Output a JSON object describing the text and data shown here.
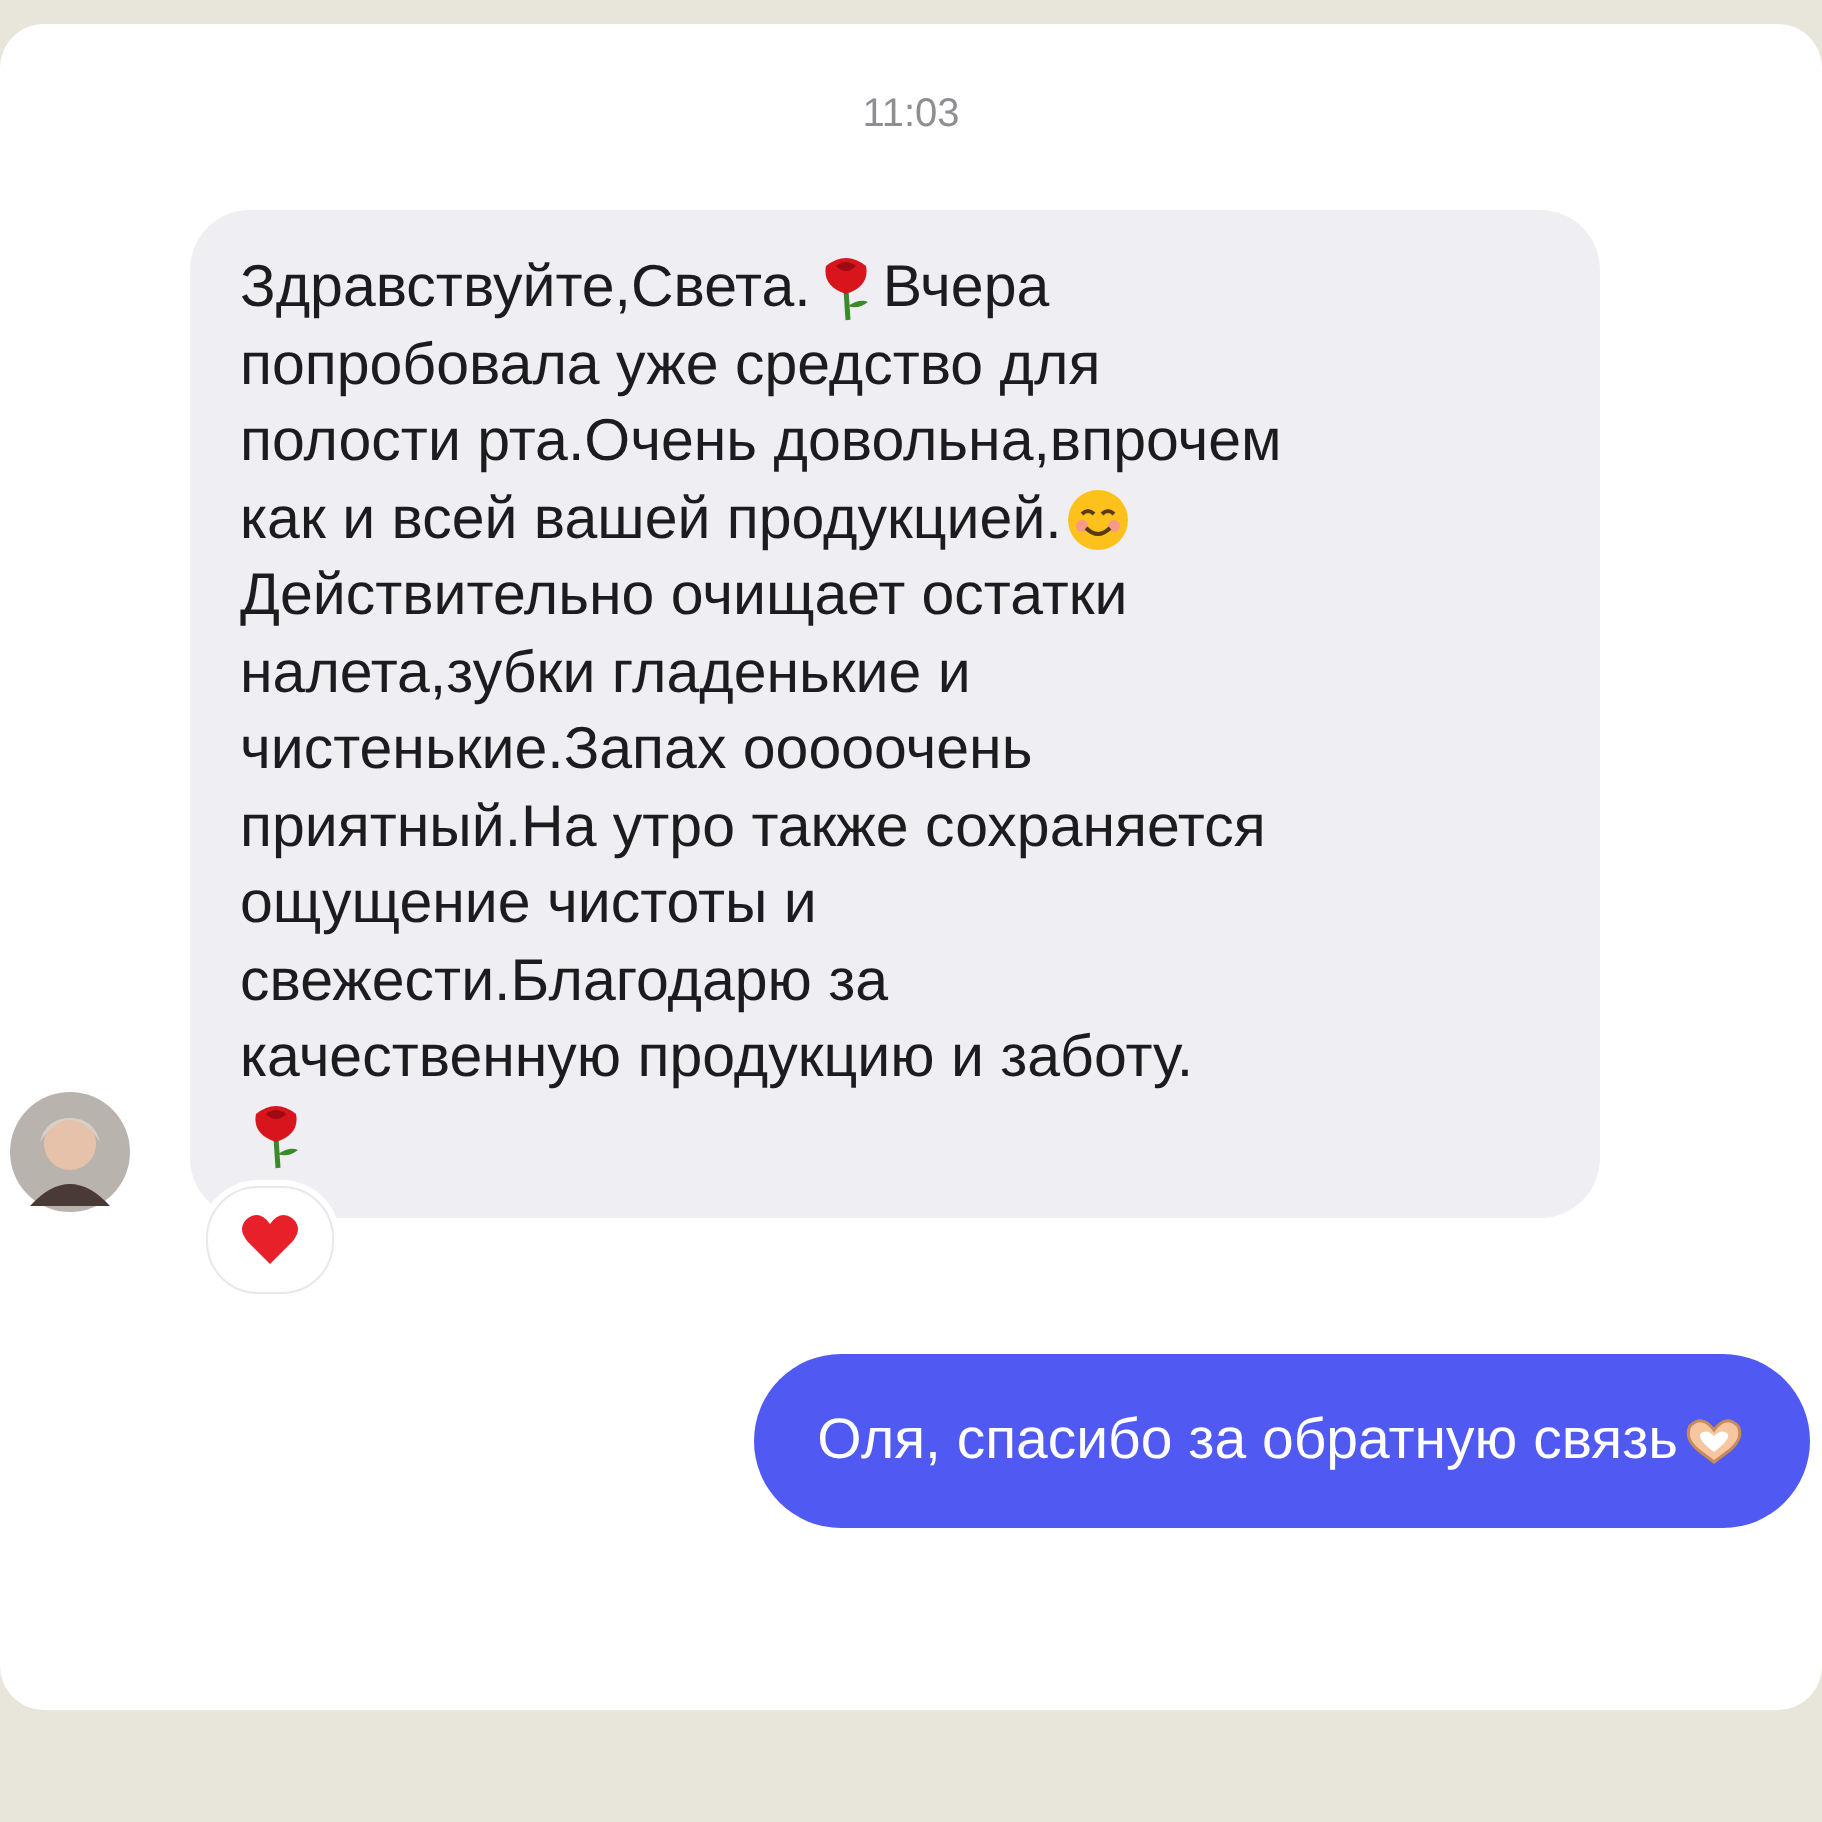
{
  "timestamp": "11:03",
  "messages": [
    {
      "kind": "incoming",
      "reaction": {
        "kind": "heart"
      },
      "lines": [
        [
          {
            "kind": "text",
            "text": "Здравствуйте,Света."
          },
          {
            "kind": "rose"
          },
          {
            "kind": "text",
            "text": "Вчера"
          }
        ],
        [
          {
            "kind": "text",
            "text": "попробовала уже средство для"
          }
        ],
        [
          {
            "kind": "text",
            "text": "полости рта.Очень довольна,впрочем"
          }
        ],
        [
          {
            "kind": "text",
            "text": "как и всей вашей продукцией."
          },
          {
            "kind": "smile"
          }
        ],
        [
          {
            "kind": "text",
            "text": "Действительно очищает остатки"
          }
        ],
        [
          {
            "kind": "text",
            "text": "налета,зубки гладенькие и"
          }
        ],
        [
          {
            "kind": "text",
            "text": "чистенькие.Запах ооооочень"
          }
        ],
        [
          {
            "kind": "text",
            "text": "приятный.На утро также сохраняется"
          }
        ],
        [
          {
            "kind": "text",
            "text": "ощущение чистоты и"
          }
        ],
        [
          {
            "kind": "text",
            "text": "свежести.Благодарю за"
          }
        ],
        [
          {
            "kind": "text",
            "text": "качественную продукцию и заботу."
          }
        ],
        [
          {
            "kind": "rose"
          }
        ]
      ]
    },
    {
      "kind": "outgoing",
      "lines": [
        [
          {
            "kind": "text",
            "text": "Оля, спасибо за обратную связь"
          },
          {
            "kind": "hearthands"
          }
        ]
      ]
    }
  ]
}
